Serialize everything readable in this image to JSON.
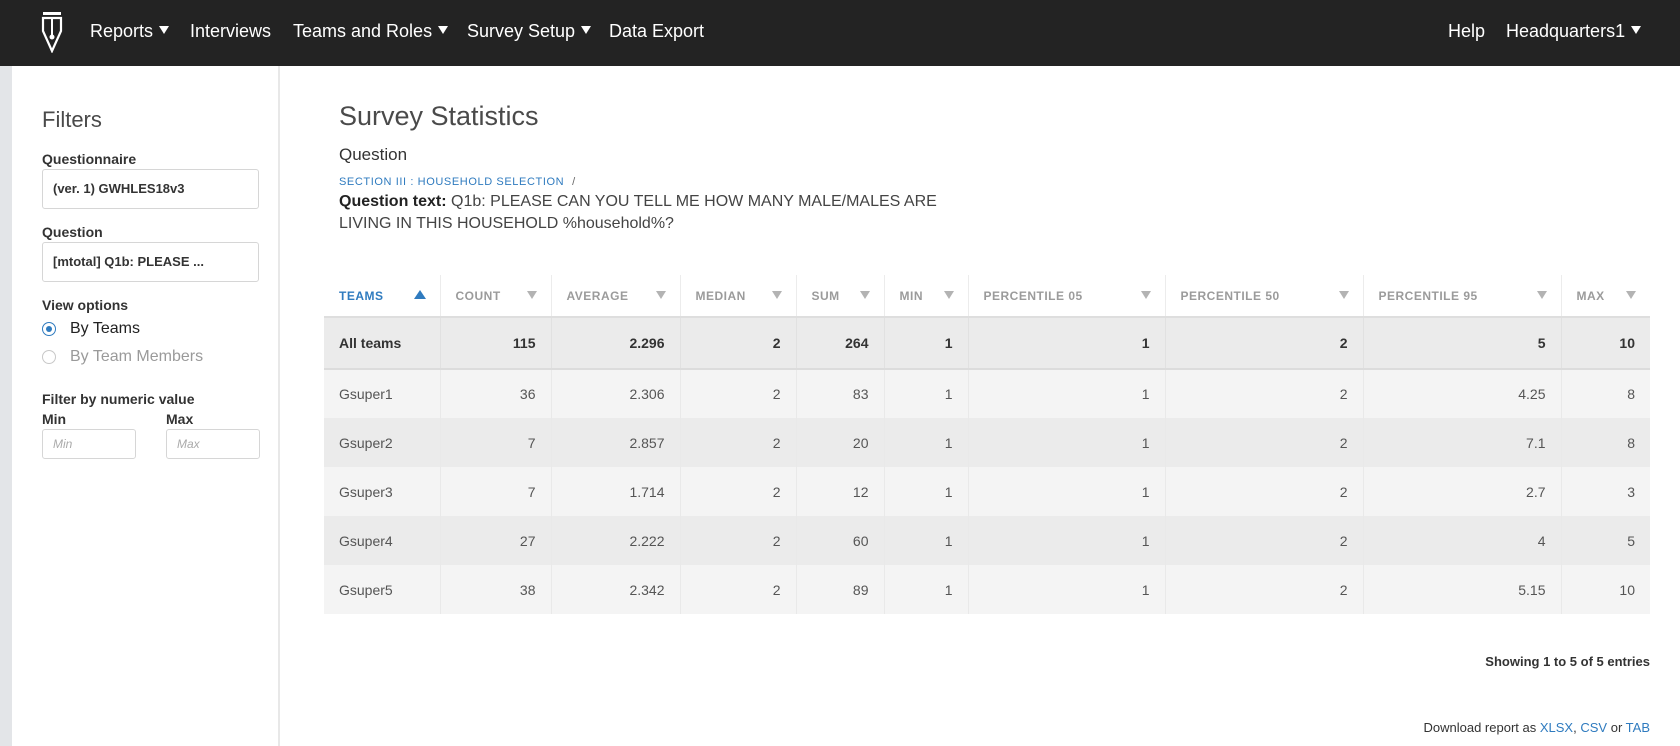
{
  "nav": {
    "items": [
      {
        "label": "Reports",
        "dropdown": true
      },
      {
        "label": "Interviews",
        "dropdown": false
      },
      {
        "label": "Teams and Roles",
        "dropdown": true
      },
      {
        "label": "Survey Setup",
        "dropdown": true
      },
      {
        "label": "Data Export",
        "dropdown": false
      }
    ],
    "help": "Help",
    "user": "Headquarters1",
    "logo_icon": "pen-nib-logo-icon"
  },
  "filters": {
    "title": "Filters",
    "questionnaire_label": "Questionnaire",
    "questionnaire_value": "(ver. 1) GWHLES18v3",
    "question_label": "Question",
    "question_value": "[mtotal] Q1b: PLEASE ...",
    "view_options_label": "View options",
    "view_options": [
      {
        "label": "By Teams",
        "selected": true
      },
      {
        "label": "By Team Members",
        "selected": false
      }
    ],
    "numeric_label": "Filter by numeric value",
    "min_label": "Min",
    "max_label": "Max",
    "min_placeholder": "Min",
    "max_placeholder": "Max"
  },
  "main": {
    "title": "Survey Statistics",
    "subtitle": "Question",
    "breadcrumb": "Section III : Household Selection",
    "breadcrumb_sep": "/",
    "question_text_label": "Question text:",
    "question_text": "Q1b: PLEASE CAN YOU TELL ME HOW MANY MALE/MALES ARE LIVING IN THIS HOUSEHOLD %household%?"
  },
  "table": {
    "columns": [
      "Teams",
      "Count",
      "Average",
      "Median",
      "Sum",
      "Min",
      "Percentile 05",
      "Percentile 50",
      "Percentile 95",
      "Max"
    ],
    "sorted_column": "Teams",
    "total": [
      "All teams",
      "115",
      "2.296",
      "2",
      "264",
      "1",
      "1",
      "2",
      "5",
      "10"
    ],
    "rows": [
      [
        "Gsuper1",
        "36",
        "2.306",
        "2",
        "83",
        "1",
        "1",
        "2",
        "4.25",
        "8"
      ],
      [
        "Gsuper2",
        "7",
        "2.857",
        "2",
        "20",
        "1",
        "1",
        "2",
        "7.1",
        "8"
      ],
      [
        "Gsuper3",
        "7",
        "1.714",
        "2",
        "12",
        "1",
        "1",
        "2",
        "2.7",
        "3"
      ],
      [
        "Gsuper4",
        "27",
        "2.222",
        "2",
        "60",
        "1",
        "1",
        "2",
        "4",
        "5"
      ],
      [
        "Gsuper5",
        "38",
        "2.342",
        "2",
        "89",
        "1",
        "1",
        "2",
        "5.15",
        "10"
      ]
    ]
  },
  "footer": {
    "showing": "Showing 1 to 5 of 5 entries",
    "download_prefix": "Download report as",
    "formats": [
      "XLSX",
      "CSV",
      "TAB"
    ],
    "sep_comma": ",",
    "sep_or": "or"
  },
  "colors": {
    "topbar": "#232323",
    "accent": "#2f7bbf",
    "row_total": "#ebebeb",
    "row_odd": "#f4f4f4"
  }
}
